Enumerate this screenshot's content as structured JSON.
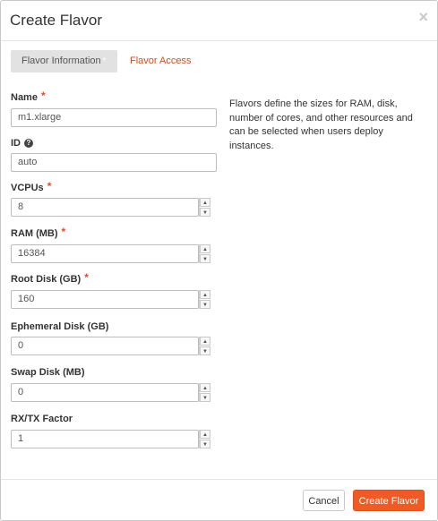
{
  "modal": {
    "title": "Create Flavor",
    "close_label": "×"
  },
  "tabs": [
    {
      "label": "Flavor Information",
      "required_marker": "*",
      "active": true
    },
    {
      "label": "Flavor Access",
      "active": false
    }
  ],
  "fields": {
    "name": {
      "label": "Name",
      "required": "*",
      "value": "m1.xlarge"
    },
    "id": {
      "label": "ID",
      "help_icon": "?",
      "value": "auto"
    },
    "vcpus": {
      "label": "VCPUs",
      "required": "*",
      "value": "8"
    },
    "ram": {
      "label": "RAM (MB)",
      "required": "*",
      "value": "16384"
    },
    "root_disk": {
      "label": "Root Disk (GB)",
      "required": "*",
      "value": "160"
    },
    "ephemeral_disk": {
      "label": "Ephemeral Disk (GB)",
      "value": "0"
    },
    "swap_disk": {
      "label": "Swap Disk (MB)",
      "value": "0"
    },
    "rxtx_factor": {
      "label": "RX/TX Factor",
      "value": "1"
    }
  },
  "description": "Flavors define the sizes for RAM, disk, number of cores, and other resources and can be selected when users deploy instances.",
  "spinner": {
    "up_glyph": "▲",
    "down_glyph": "▼"
  },
  "footer": {
    "cancel_label": "Cancel",
    "submit_label": "Create Flavor"
  },
  "colors": {
    "accent": "#ef5a27",
    "required": "#e4492c",
    "tab_link": "#d24d1f"
  }
}
